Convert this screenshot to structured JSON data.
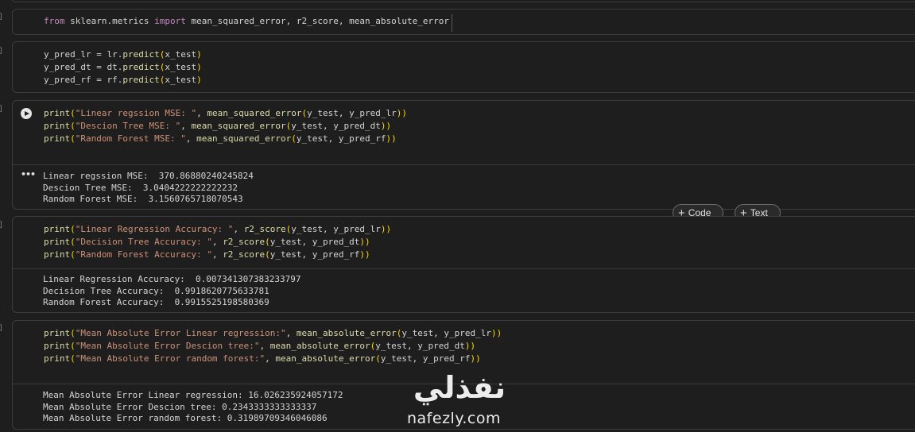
{
  "gutter_mark": "]",
  "cells": [
    {
      "id": "imports",
      "lines": [
        [
          [
            "kw",
            "from"
          ],
          [
            "vr",
            " sklearn.metrics "
          ],
          [
            "kw",
            "import"
          ],
          [
            "vr",
            " mean_squared_error, r2_score, mean_absolute_error"
          ]
        ]
      ]
    },
    {
      "id": "predictions",
      "lines": [
        [
          [
            "vr",
            "y_pred_lr = lr."
          ],
          [
            "fn",
            "predict"
          ],
          [
            "pn",
            "("
          ],
          [
            "vr",
            "x_test"
          ],
          [
            "pn",
            ")"
          ]
        ],
        [
          [
            "vr",
            "y_pred_dt = dt."
          ],
          [
            "fn",
            "predict"
          ],
          [
            "pn",
            "("
          ],
          [
            "vr",
            "x_test"
          ],
          [
            "pn",
            ")"
          ]
        ],
        [
          [
            "vr",
            "y_pred_rf = rf."
          ],
          [
            "fn",
            "predict"
          ],
          [
            "pn",
            "("
          ],
          [
            "vr",
            "x_test"
          ],
          [
            "pn",
            ")"
          ]
        ]
      ]
    },
    {
      "id": "mse",
      "lines": [
        [
          [
            "fn",
            "print"
          ],
          [
            "pn",
            "("
          ],
          [
            "str",
            "\"Linear regssion MSE: \""
          ],
          [
            "vr",
            ", "
          ],
          [
            "fn",
            "mean_squared_error"
          ],
          [
            "pn",
            "("
          ],
          [
            "vr",
            "y_test, y_pred_lr"
          ],
          [
            "pn",
            "))"
          ]
        ],
        [
          [
            "fn",
            "print"
          ],
          [
            "pn",
            "("
          ],
          [
            "str",
            "\"Descion Tree MSE: \""
          ],
          [
            "vr",
            ", "
          ],
          [
            "fn",
            "mean_squared_error"
          ],
          [
            "pn",
            "("
          ],
          [
            "vr",
            "y_test, y_pred_dt"
          ],
          [
            "pn",
            "))"
          ]
        ],
        [
          [
            "fn",
            "print"
          ],
          [
            "pn",
            "("
          ],
          [
            "str",
            "\"Random Forest MSE: \""
          ],
          [
            "vr",
            ", "
          ],
          [
            "fn",
            "mean_squared_error"
          ],
          [
            "pn",
            "("
          ],
          [
            "vr",
            "y_test, y_pred_rf"
          ],
          [
            "pn",
            "))"
          ]
        ]
      ],
      "output": [
        "Linear regssion MSE:  370.86880240245824",
        "Descion Tree MSE:  3.0404222222222232",
        "Random Forest MSE:  3.1560765718070543"
      ]
    },
    {
      "id": "r2",
      "lines": [
        [
          [
            "fn",
            "print"
          ],
          [
            "pn",
            "("
          ],
          [
            "str",
            "\"Linear Regression Accuracy: \""
          ],
          [
            "vr",
            ", "
          ],
          [
            "fn",
            "r2_score"
          ],
          [
            "pn",
            "("
          ],
          [
            "vr",
            "y_test, y_pred_lr"
          ],
          [
            "pn",
            "))"
          ]
        ],
        [
          [
            "fn",
            "print"
          ],
          [
            "pn",
            "("
          ],
          [
            "str",
            "\"Decision Tree Accuracy: \""
          ],
          [
            "vr",
            ", "
          ],
          [
            "fn",
            "r2_score"
          ],
          [
            "pn",
            "("
          ],
          [
            "vr",
            "y_test, y_pred_dt"
          ],
          [
            "pn",
            "))"
          ]
        ],
        [
          [
            "fn",
            "print"
          ],
          [
            "pn",
            "("
          ],
          [
            "str",
            "\"Random Forest Accuracy: \""
          ],
          [
            "vr",
            ", "
          ],
          [
            "fn",
            "r2_score"
          ],
          [
            "pn",
            "("
          ],
          [
            "vr",
            "y_test, y_pred_rf"
          ],
          [
            "pn",
            "))"
          ]
        ]
      ],
      "output": [
        "Linear Regression Accuracy:  0.007341307383233797",
        "Decision Tree Accuracy:  0.9918620775633781",
        "Random Forest Accuracy:  0.9915525198580369"
      ]
    },
    {
      "id": "mae",
      "lines": [
        [
          [
            "fn",
            "print"
          ],
          [
            "pn",
            "("
          ],
          [
            "str",
            "\"Mean Absolute Error Linear regression:\""
          ],
          [
            "vr",
            ", "
          ],
          [
            "fn",
            "mean_absolute_error"
          ],
          [
            "pn",
            "("
          ],
          [
            "vr",
            "y_test, y_pred_lr"
          ],
          [
            "pn",
            "))"
          ]
        ],
        [
          [
            "fn",
            "print"
          ],
          [
            "pn",
            "("
          ],
          [
            "str",
            "\"Mean Absolute Error Descion tree:\""
          ],
          [
            "vr",
            ", "
          ],
          [
            "fn",
            "mean_absolute_error"
          ],
          [
            "pn",
            "("
          ],
          [
            "vr",
            "y_test, y_pred_dt"
          ],
          [
            "pn",
            "))"
          ]
        ],
        [
          [
            "fn",
            "print"
          ],
          [
            "pn",
            "("
          ],
          [
            "str",
            "\"Mean Absolute Error random forest:\""
          ],
          [
            "vr",
            ", "
          ],
          [
            "fn",
            "mean_absolute_error"
          ],
          [
            "pn",
            "("
          ],
          [
            "vr",
            "y_test, y_pred_rf"
          ],
          [
            "pn",
            "))"
          ]
        ]
      ],
      "output": [
        "Mean Absolute Error Linear regression: 16.026235924057172",
        "Mean Absolute Error Descion tree: 0.2343333333333337",
        "Mean Absolute Error random forest: 0.31989709346046086"
      ]
    }
  ],
  "toolbar": {
    "add_code_label": "Code",
    "add_text_label": "Text"
  },
  "output_menu_glyph": "•••",
  "watermark": {
    "logo_text": "نفذلي",
    "url_text": "nafezly.com"
  },
  "colors": {
    "background": "#1e1e1e",
    "keyword": "#c586c0",
    "function": "#dcdcaa",
    "string": "#ce9178",
    "bracket": "#ffd700",
    "text": "#d4d4d4"
  }
}
